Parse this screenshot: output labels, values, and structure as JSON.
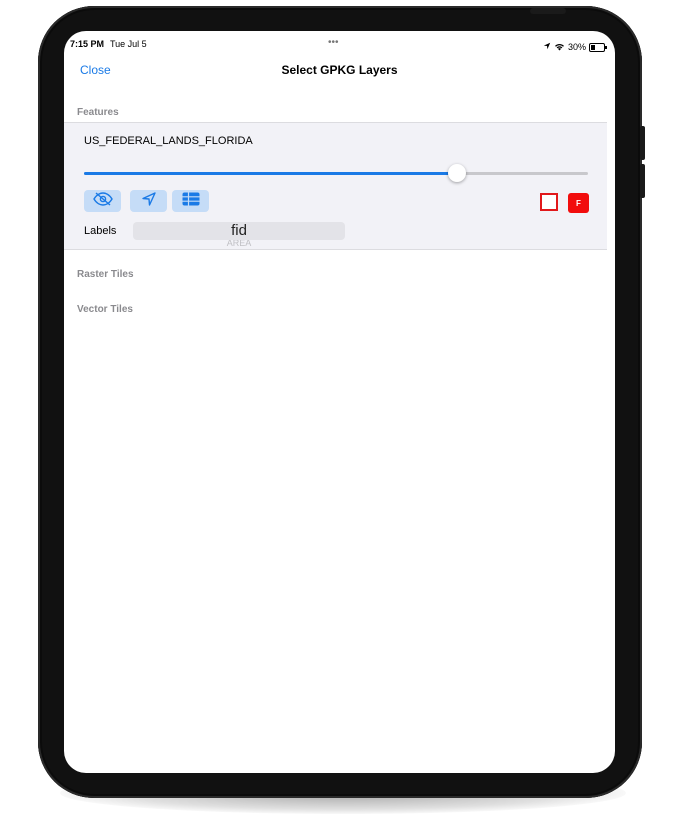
{
  "status_bar": {
    "time": "7:15 PM",
    "date": "Tue Jul 5",
    "dots": "•••",
    "battery": "30%"
  },
  "nav": {
    "close_label": "Close",
    "title": "Select GPKG Layers"
  },
  "sections": {
    "features": "Features",
    "raster_tiles": "Raster Tiles",
    "vector_tiles": "Vector Tiles"
  },
  "layer": {
    "name": "US_FEDERAL_LANDS_FLORIDA",
    "opacity": 0.74,
    "tools": [
      {
        "icon": "eye-slash-icon"
      },
      {
        "icon": "location-arrow-icon"
      },
      {
        "icon": "table-icon"
      }
    ],
    "stroke_color": "#e1181b",
    "fill_color": "#f20d0d",
    "fill_letter": "F",
    "labels_label": "Labels",
    "label_field_selected": "fid",
    "label_field_next": "AREA"
  },
  "colors": {
    "accent": "#1a7ae6",
    "button_bg": "#c5dcf7"
  }
}
